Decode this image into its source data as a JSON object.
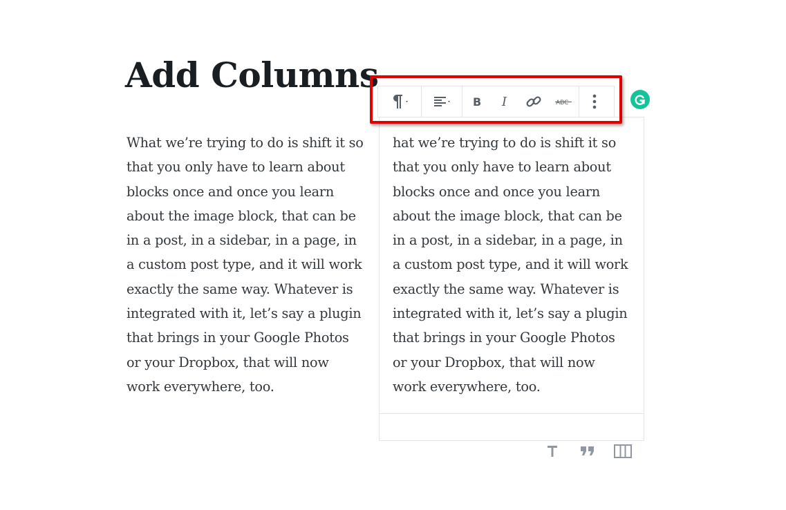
{
  "heading": {
    "title": "Add Columns"
  },
  "columns": [
    {
      "text": "What we’re trying to do is shift it so\nthat you only have to learn about\nblocks once and once you learn\nabout the image block, that can be\nin a post, in a sidebar, in a page, in\na custom post type, and it will work\nexactly the same way. Whatever is\nintegrated with it, let’s say a plugin\nthat brings in your Google Photos\nor your Dropbox, that will now\nwork everywhere, too."
    },
    {
      "text": "hat we’re trying to do is shift it so\nthat you only have to learn about\nblocks once and once you learn\nabout the image block, that can be\nin a post, in a sidebar, in a page, in\na custom post type, and it will work\nexactly the same way. Whatever is\nintegrated with it, let’s say a plugin\nthat brings in your Google Photos\nor your Dropbox, that will now\nwork everywhere, too."
    }
  ],
  "toolbar": {
    "items": [
      "pilcrow-icon",
      "align-left-icon",
      "bold-icon",
      "italic-icon",
      "link-icon",
      "strikethrough-icon",
      "more-options-icon"
    ],
    "highlight_color": "#e00000"
  },
  "grammarly": {
    "color": "#15c39a",
    "icon": "grammarly-icon"
  },
  "inserters": [
    "heading-block-icon",
    "quote-block-icon",
    "columns-block-icon"
  ]
}
